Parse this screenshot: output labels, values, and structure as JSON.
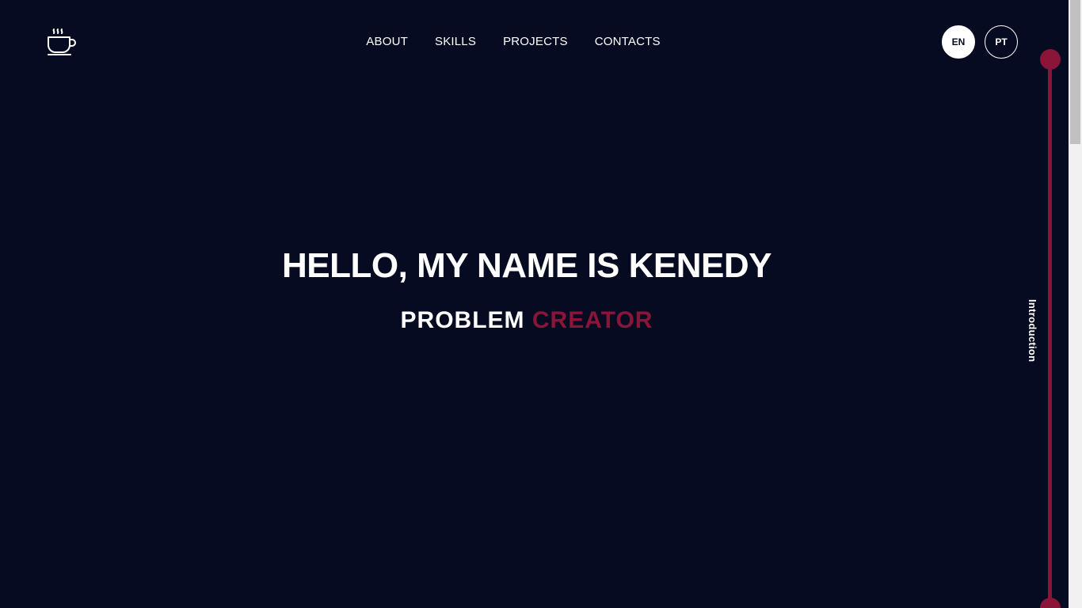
{
  "header": {
    "logo_icon": "coffee-cup-icon",
    "nav": [
      {
        "label": "ABOUT"
      },
      {
        "label": "SKILLS"
      },
      {
        "label": "PROJECTS"
      },
      {
        "label": "CONTACTS"
      }
    ],
    "languages": [
      {
        "label": "EN",
        "active": true
      },
      {
        "label": "PT",
        "active": false
      }
    ]
  },
  "hero": {
    "title": "HELLO, MY NAME IS KENEDY",
    "subtitle_word1": "PROBLEM",
    "subtitle_word2": "CREATOR"
  },
  "timeline": {
    "section_label": "Introduction"
  },
  "colors": {
    "background": "#060b21",
    "accent": "#8a1538",
    "text": "#ffffff"
  }
}
